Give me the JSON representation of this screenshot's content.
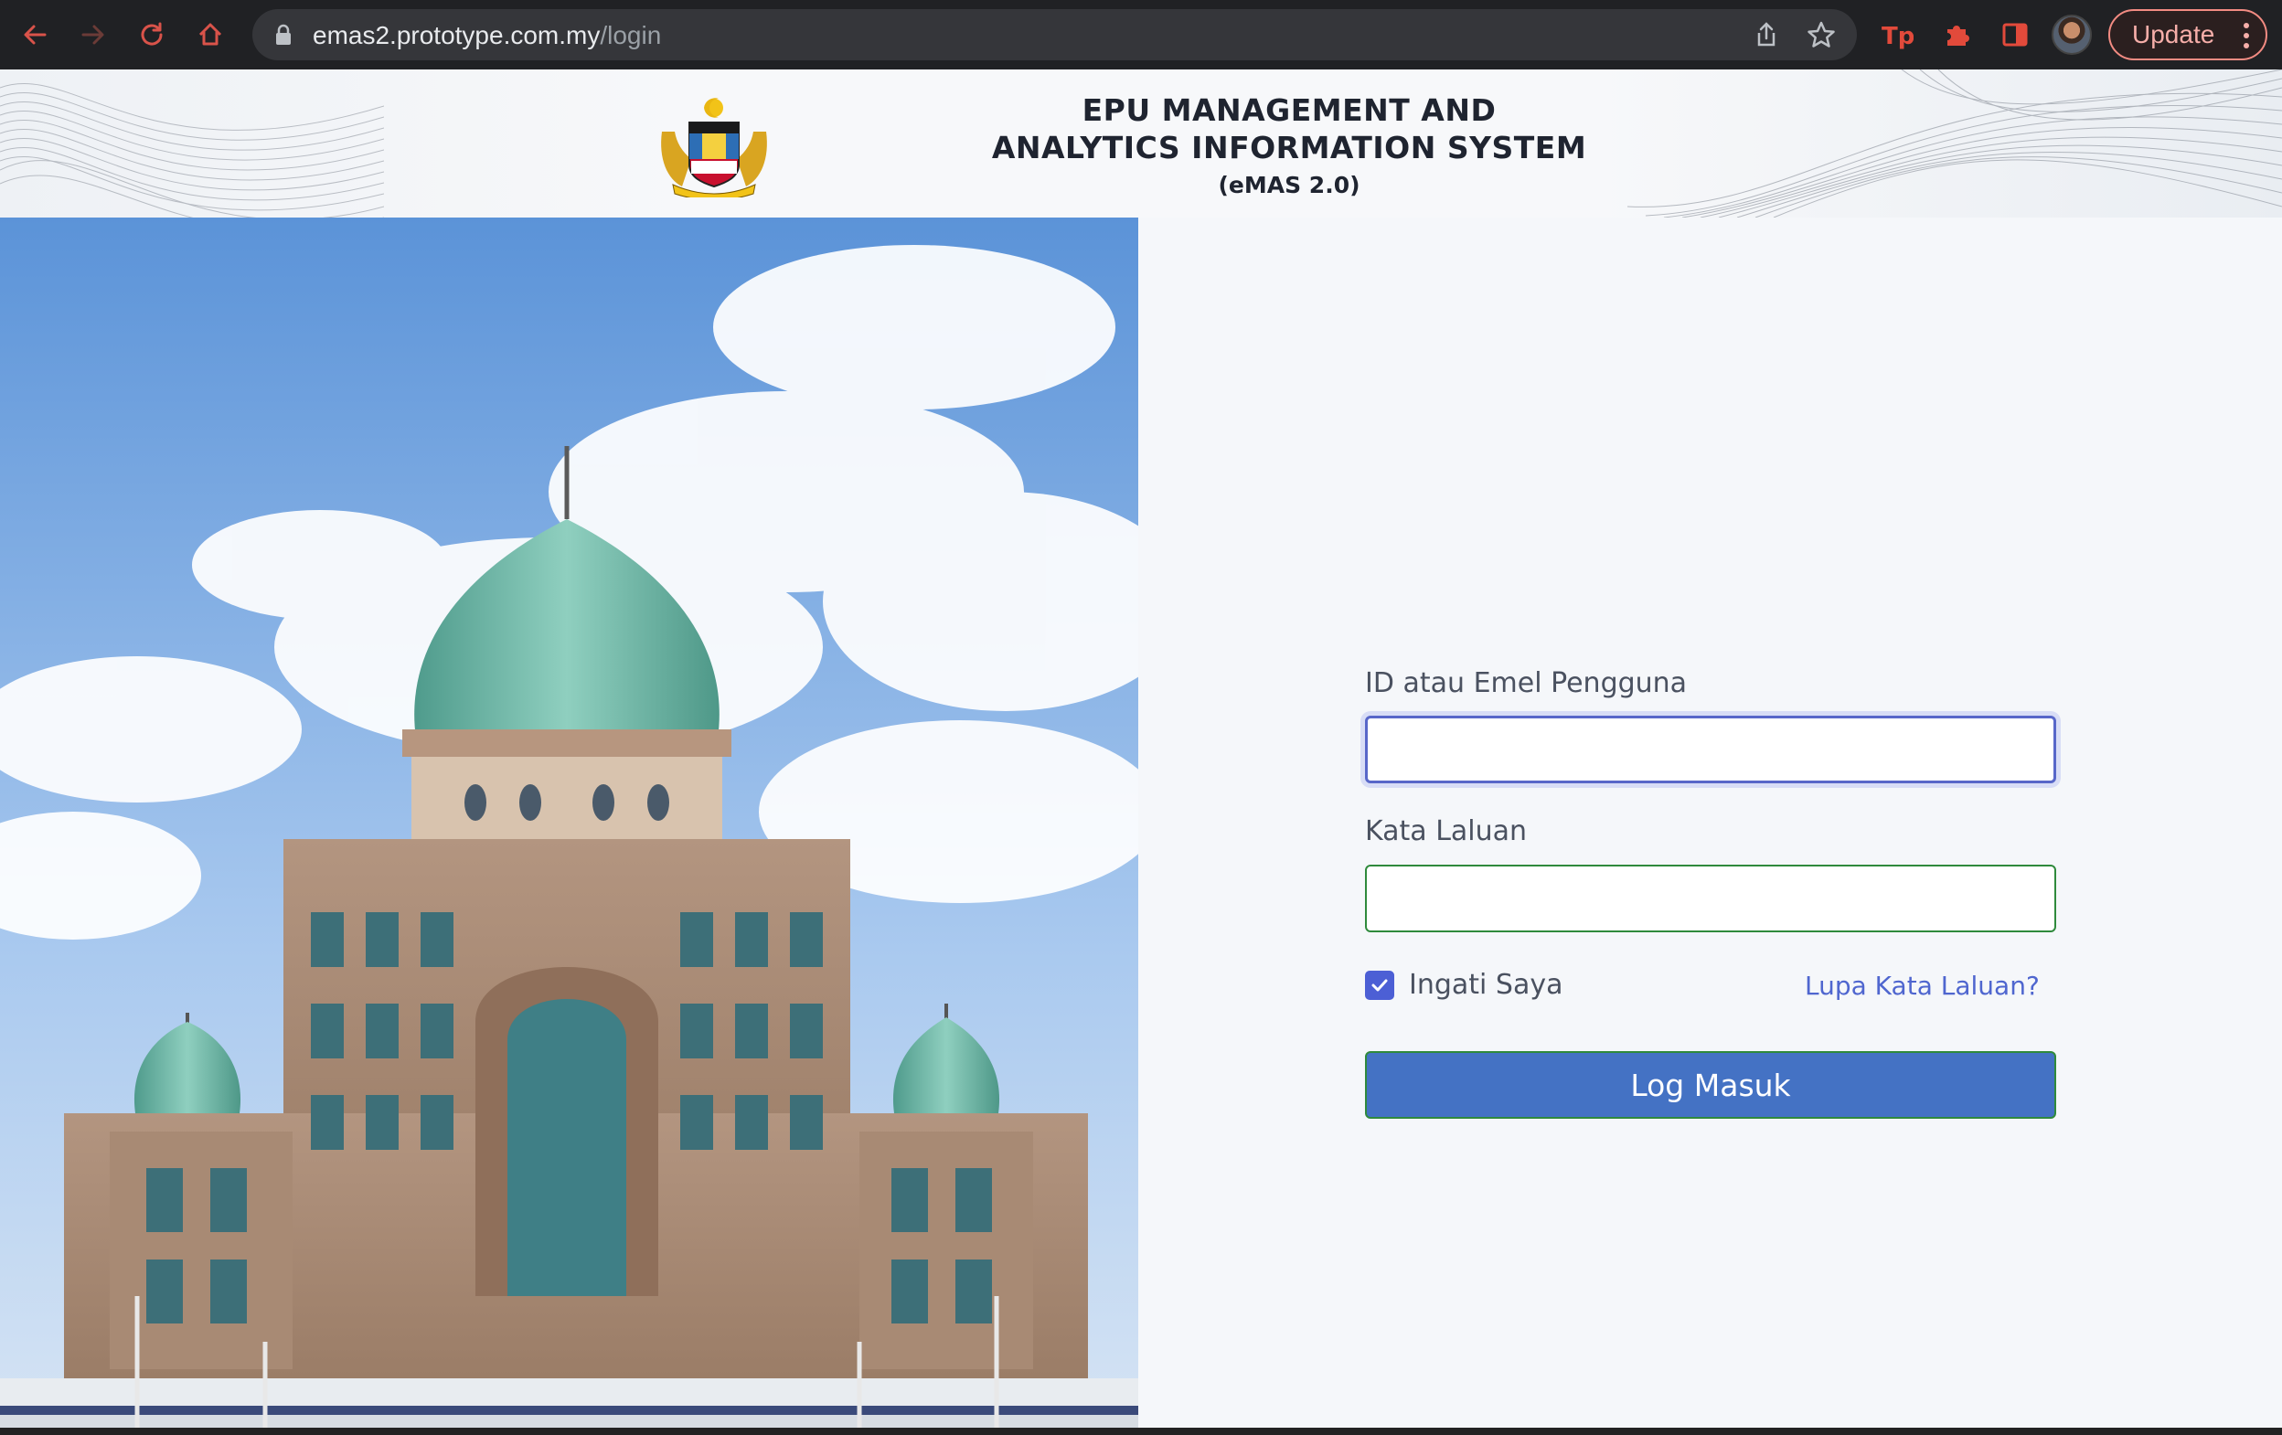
{
  "browser": {
    "url_host": "emas2.prototype.com.my",
    "url_path": "/login",
    "update_label": "Update",
    "icons": [
      "back-icon",
      "forward-icon",
      "reload-icon",
      "home-icon",
      "lock-icon",
      "share-icon",
      "star-icon",
      "extension-tp-icon",
      "puzzle-icon",
      "sidepanel-icon",
      "kebab-menu-icon"
    ],
    "accent_color": "#e24a3b"
  },
  "header": {
    "title_line1": "EPU MANAGEMENT AND",
    "title_line2": "ANALYTICS INFORMATION SYSTEM",
    "title_line3": "(eMAS 2.0)"
  },
  "login": {
    "username_label": "ID atau Emel Pengguna",
    "username_value": "",
    "password_label": "Kata Laluan",
    "password_value": "",
    "remember_label": "Ingati Saya",
    "remember_checked": true,
    "forgot_label": "Lupa Kata Laluan?",
    "submit_label": "Log Masuk",
    "colors": {
      "button": "#4472c4",
      "link": "#4f66cf",
      "checkbox": "#4c5fd5",
      "focus": "#5867c9"
    }
  }
}
